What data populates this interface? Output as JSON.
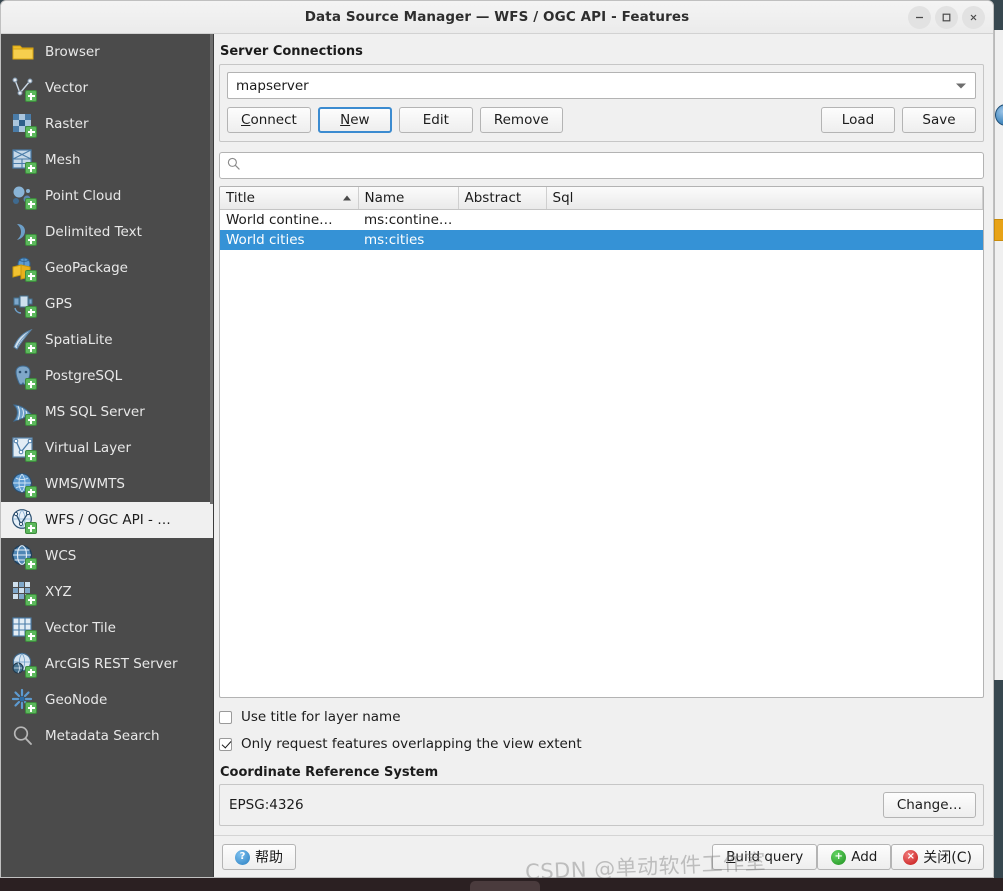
{
  "window": {
    "title": "Data Source Manager — WFS / OGC API - Features",
    "minimize_label": "—",
    "maximize_label": "□",
    "close_label": "×"
  },
  "sidebar": {
    "items": [
      {
        "label": "Browser",
        "icon": "folder-icon",
        "badge": false,
        "active": false
      },
      {
        "label": "Vector",
        "icon": "vector-layer-icon",
        "badge": true,
        "active": false
      },
      {
        "label": "Raster",
        "icon": "raster-layer-icon",
        "badge": true,
        "active": false
      },
      {
        "label": "Mesh",
        "icon": "mesh-layer-icon",
        "badge": true,
        "active": false
      },
      {
        "label": "Point Cloud",
        "icon": "point-cloud-icon",
        "badge": true,
        "active": false
      },
      {
        "label": "Delimited Text",
        "icon": "delimited-text-icon",
        "badge": true,
        "active": false
      },
      {
        "label": "GeoPackage",
        "icon": "geopackage-icon",
        "badge": true,
        "active": false
      },
      {
        "label": "GPS",
        "icon": "gps-icon",
        "badge": true,
        "active": false
      },
      {
        "label": "SpatiaLite",
        "icon": "spatialite-icon",
        "badge": true,
        "active": false
      },
      {
        "label": "PostgreSQL",
        "icon": "postgresql-icon",
        "badge": true,
        "active": false
      },
      {
        "label": "MS SQL Server",
        "icon": "mssql-server-icon",
        "badge": true,
        "active": false
      },
      {
        "label": "Virtual Layer",
        "icon": "virtual-layer-icon",
        "badge": true,
        "active": false
      },
      {
        "label": "WMS/WMTS",
        "icon": "wms-wmts-icon",
        "badge": true,
        "active": false
      },
      {
        "label": "WFS / OGC API - …",
        "icon": "wfs-ogc-api-icon",
        "badge": true,
        "active": true
      },
      {
        "label": "WCS",
        "icon": "wcs-icon",
        "badge": true,
        "active": false
      },
      {
        "label": "XYZ",
        "icon": "xyz-tiles-icon",
        "badge": true,
        "active": false
      },
      {
        "label": "Vector Tile",
        "icon": "vector-tile-icon",
        "badge": true,
        "active": false
      },
      {
        "label": "ArcGIS REST Server",
        "icon": "arcgis-rest-icon",
        "badge": true,
        "active": false
      },
      {
        "label": "GeoNode",
        "icon": "geonode-icon",
        "badge": true,
        "active": false
      },
      {
        "label": "Metadata Search",
        "icon": "search-icon",
        "badge": false,
        "active": false
      }
    ]
  },
  "server_connections": {
    "group_title": "Server Connections",
    "selected_connection": "mapserver",
    "buttons": {
      "connect": "Connect",
      "connect_mnemonic": "C",
      "new": "New",
      "new_mnemonic": "N",
      "edit": "Edit",
      "remove": "Remove",
      "load": "Load",
      "save": "Save"
    }
  },
  "search": {
    "value": "",
    "placeholder": ""
  },
  "layers_table": {
    "columns": [
      "Title",
      "Name",
      "Abstract",
      "Sql"
    ],
    "sorted_column": "Title",
    "sort_direction": "ascending",
    "rows": [
      {
        "title": "World contine…",
        "name": "ms:contine…",
        "abstract": "",
        "sql": "",
        "selected": false
      },
      {
        "title": "World cities",
        "name": "ms:cities",
        "abstract": "",
        "sql": "",
        "selected": true
      }
    ]
  },
  "options": {
    "use_title_for_layer_name": {
      "label": "Use title for layer name",
      "checked": false
    },
    "only_request_overlapping": {
      "label": "Only request features overlapping the view extent",
      "checked": true
    }
  },
  "crs": {
    "group_title": "Coordinate Reference System",
    "value": "EPSG:4326",
    "change_button": "Change…"
  },
  "bottom_bar": {
    "help": "帮助",
    "build_query": "Build query",
    "build_query_mnemonic": "B",
    "add": "Add",
    "close": "关闭(C)"
  },
  "watermark": {
    "text": "CSDN @单动软件工作室"
  },
  "colors": {
    "sidebar_bg": "#4b4b4b",
    "panel_bg": "#f0f0f0",
    "selection_blue": "#3592d6",
    "focus_blue": "#3b8bd0",
    "badge_green": "#5cb85c"
  }
}
